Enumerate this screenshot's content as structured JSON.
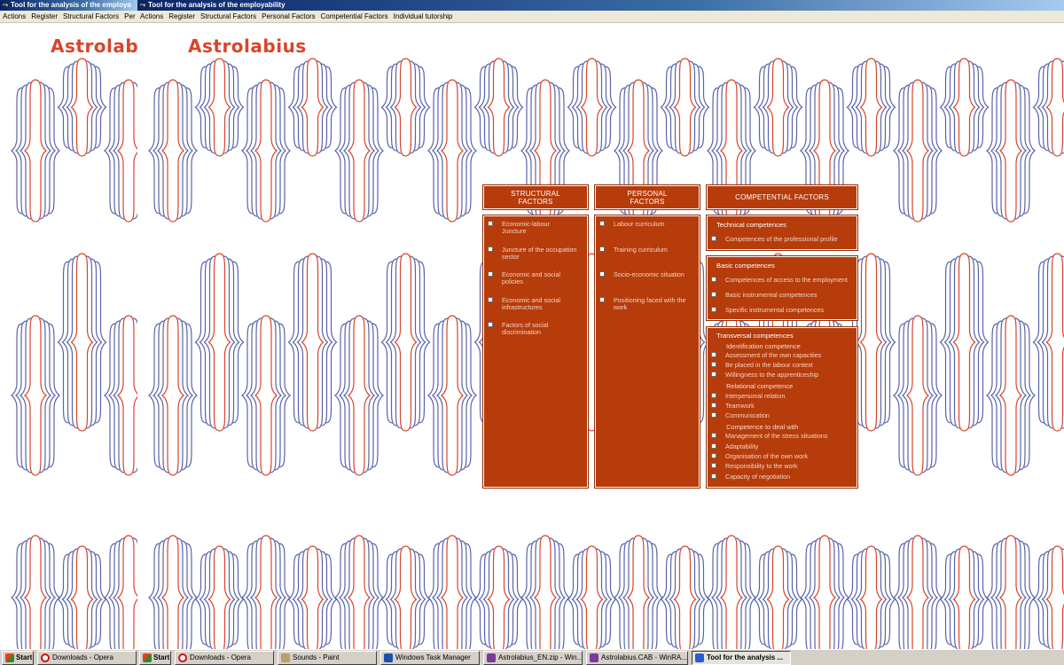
{
  "window_back": {
    "title": "Tool for the analysis of the employa",
    "menu": [
      "Actions",
      "Register",
      "Structural Factors",
      "Per"
    ],
    "logo": "Astrolabius"
  },
  "window_front": {
    "title": "Tool for the analysis of the employability",
    "menu": [
      "Actions",
      "Register",
      "Structural Factors",
      "Personal Factors",
      "Competential Factors",
      "Individual tutorship"
    ],
    "logo": "Astrolabius"
  },
  "colors": {
    "panel": "#b63c0b",
    "logo": "#d8452a",
    "pattern_blue": "#5a63a8",
    "pattern_red": "#d8452a",
    "titlebar": "#0a246a"
  },
  "structural": {
    "header": [
      "STRUCTURAL",
      "FACTORS"
    ],
    "items": [
      [
        "Economic-labour",
        "Juncture"
      ],
      [
        "Juncture of the occupation",
        "sector"
      ],
      [
        "Economic and social",
        "policies"
      ],
      [
        "Economic and social",
        "infrastructures"
      ],
      [
        "Factors of social",
        "discrimination"
      ]
    ]
  },
  "personal": {
    "header": [
      "PERSONAL",
      "FACTORS"
    ],
    "items": [
      [
        "Labour curriculum"
      ],
      [
        "Training curriculum"
      ],
      [
        "Socio-economic situation"
      ],
      [
        "Positioning faced with the",
        "work"
      ]
    ]
  },
  "competential": {
    "header": "COMPETENTIAL FACTORS",
    "technical": {
      "title": "Technical competences",
      "items": [
        "Competences of the professional profile"
      ]
    },
    "basic": {
      "title": "Basic competences",
      "items": [
        "Competences of access to the employment",
        "Basic instrumental competences",
        "Specific instrumental competences"
      ]
    },
    "transversal": {
      "title": "Transversal competences",
      "groups": [
        {
          "title": "Identification competence",
          "items": [
            "Assessment of the own capacities",
            "Be placed in the labour context",
            "Willingness  to the apprenticeship"
          ]
        },
        {
          "title": "Relational competence",
          "items": [
            "Interpersonal relation",
            "Teamwork",
            "Communication"
          ]
        },
        {
          "title": "Competence to deal with",
          "items": [
            "Management of the stress situations",
            "Adaptability",
            "Organisation of the own work",
            "Responsibility to the work",
            "Capacity of negotiation"
          ]
        }
      ]
    }
  },
  "taskbar": {
    "start_label": "Start",
    "tasks": [
      {
        "label": "Start",
        "icon": "windows-icon"
      },
      {
        "label": "Downloads - Opera",
        "icon": "opera-icon"
      },
      {
        "label": "Start",
        "icon": "windows-icon"
      },
      {
        "label": "Downloads - Opera",
        "icon": "opera-icon"
      },
      {
        "label": "Sounds - Paint",
        "icon": "paint-icon"
      },
      {
        "label": "Windows Task Manager",
        "icon": "task-manager-icon"
      },
      {
        "label": "Astrolabius_EN.zip - Win...",
        "icon": "winrar-icon"
      },
      {
        "label": "Astrolabius.CAB - WinRA...",
        "icon": "winrar-icon"
      },
      {
        "label": "Tool for the analysis ...",
        "icon": "app-icon"
      }
    ]
  }
}
